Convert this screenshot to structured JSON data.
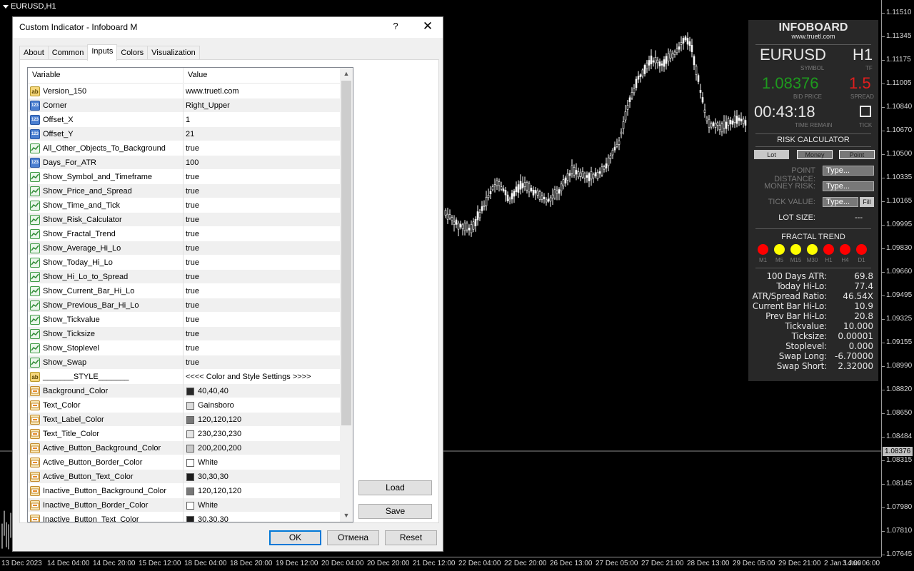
{
  "chart": {
    "symbol_tf": "EURUSD,H1",
    "price_labels": [
      "1.11510",
      "1.11345",
      "1.11175",
      "1.11005",
      "1.10840",
      "1.10670",
      "1.10500",
      "1.10335",
      "1.10165",
      "1.09995",
      "1.09830",
      "1.09660",
      "1.09495",
      "1.09325",
      "1.09155",
      "1.08990",
      "1.08820",
      "1.08650",
      "1.08484",
      "1.08315",
      "1.08145",
      "1.07980",
      "1.07810",
      "1.07645"
    ],
    "current_price": "1.08376",
    "time_labels": [
      "13 Dec 2023",
      "14 Dec 04:00",
      "14 Dec 20:00",
      "15 Dec 12:00",
      "18 Dec 04:00",
      "18 Dec 20:00",
      "19 Dec 12:00",
      "20 Dec 04:00",
      "20 Dec 20:00",
      "21 Dec 12:00",
      "22 Dec 04:00",
      "22 Dec 20:00",
      "26 Dec 13:00",
      "27 Dec 05:00",
      "27 Dec 21:00",
      "28 Dec 13:00",
      "29 Dec 05:00",
      "29 Dec 21:00",
      "2 Jan 14:00",
      "3 Jan 06:00"
    ],
    "colors": {
      "candle": "#ffffff",
      "axis": "#9a9a9a",
      "bid_line": "#8c8c8c"
    }
  },
  "infoboard": {
    "title": "INFOBOARD",
    "url": "www.truetl.com",
    "symbol": "EURUSD",
    "symbol_caption": "SYMBOL",
    "timeframe": "H1",
    "timeframe_caption": "TF",
    "bid_price": "1.08376",
    "bid_caption": "BID PRICE",
    "spread": "1.5",
    "spread_caption": "SPREAD",
    "time_remain": "00:43:18",
    "time_caption": "TIME REMAIN",
    "tick_caption": "TICK",
    "risk_title": "RISK CALCULATOR",
    "btn_lot": "Lot",
    "btn_money": "Money",
    "btn_point": "Point",
    "point_distance_label": "POINT DISTANCE:",
    "money_risk_label": "MONEY RISK:",
    "tick_value_label": "TICK VALUE:",
    "type_placeholder": "Type...",
    "fill_label": "Fill",
    "lot_size_label": "LOT SIZE:",
    "lot_size_value": "---",
    "fractal_title": "FRACTAL TREND",
    "fractal": [
      {
        "tf": "M1",
        "color": "#ff0000"
      },
      {
        "tf": "M5",
        "color": "#ffff00"
      },
      {
        "tf": "M15",
        "color": "#ffff00"
      },
      {
        "tf": "M30",
        "color": "#ffff00"
      },
      {
        "tf": "H1",
        "color": "#ff0000"
      },
      {
        "tf": "H4",
        "color": "#ff0000"
      },
      {
        "tf": "D1",
        "color": "#ff0000"
      }
    ],
    "stats": [
      {
        "label": "100 Days ATR:",
        "value": "69.8"
      },
      {
        "label": "Today Hi-Lo:",
        "value": "77.4"
      },
      {
        "label": "ATR/Spread Ratio:",
        "value": "46.54X"
      },
      {
        "label": "Current Bar Hi-Lo:",
        "value": "10.9"
      },
      {
        "label": "Prev Bar Hi-Lo:",
        "value": "20.8"
      },
      {
        "label": "Tickvalue:",
        "value": "10.000"
      },
      {
        "label": "Ticksize:",
        "value": "0.00001"
      },
      {
        "label": "Stoplevel:",
        "value": "0.000"
      },
      {
        "label": "Swap Long:",
        "value": "-6.70000"
      },
      {
        "label": "Swap Short:",
        "value": "2.32000"
      }
    ],
    "colors": {
      "bid": "#1e9a1e",
      "spread": "#e01e1e",
      "bg": "#282828"
    }
  },
  "dialog": {
    "title": "Custom Indicator - Infoboard M",
    "help": "?",
    "close": "✕",
    "tabs": [
      "About",
      "Common",
      "Inputs",
      "Colors",
      "Visualization"
    ],
    "active_tab": 2,
    "col_variable": "Variable",
    "col_value": "Value",
    "rows": [
      {
        "icon": "ab",
        "name": "Version_150",
        "value": "www.truetl.com"
      },
      {
        "icon": "123",
        "name": "Corner",
        "value": "Right_Upper"
      },
      {
        "icon": "123",
        "name": "Offset_X",
        "value": "1"
      },
      {
        "icon": "123",
        "name": "Offset_Y",
        "value": "21"
      },
      {
        "icon": "bool",
        "name": "All_Other_Objects_To_Background",
        "value": "true"
      },
      {
        "icon": "123",
        "name": "Days_For_ATR",
        "value": "100"
      },
      {
        "icon": "bool",
        "name": "Show_Symbol_and_Timeframe",
        "value": "true"
      },
      {
        "icon": "bool",
        "name": "Show_Price_and_Spread",
        "value": "true"
      },
      {
        "icon": "bool",
        "name": "Show_Time_and_Tick",
        "value": "true"
      },
      {
        "icon": "bool",
        "name": "Show_Risk_Calculator",
        "value": "true"
      },
      {
        "icon": "bool",
        "name": "Show_Fractal_Trend",
        "value": "true"
      },
      {
        "icon": "bool",
        "name": "Show_Average_Hi_Lo",
        "value": "true"
      },
      {
        "icon": "bool",
        "name": "Show_Today_Hi_Lo",
        "value": "true"
      },
      {
        "icon": "bool",
        "name": "Show_Hi_Lo_to_Spread",
        "value": "true"
      },
      {
        "icon": "bool",
        "name": "Show_Current_Bar_Hi_Lo",
        "value": "true"
      },
      {
        "icon": "bool",
        "name": "Show_Previous_Bar_Hi_Lo",
        "value": "true"
      },
      {
        "icon": "bool",
        "name": "Show_Tickvalue",
        "value": "true"
      },
      {
        "icon": "bool",
        "name": "Show_Ticksize",
        "value": "true"
      },
      {
        "icon": "bool",
        "name": "Show_Stoplevel",
        "value": "true"
      },
      {
        "icon": "bool",
        "name": "Show_Swap",
        "value": "true"
      },
      {
        "icon": "ab",
        "name": "_______STYLE_______",
        "value": "<<<< Color and Style Settings >>>>"
      },
      {
        "icon": "clr",
        "name": "Background_Color",
        "value": "40,40,40",
        "swatch": "#282828"
      },
      {
        "icon": "clr",
        "name": "Text_Color",
        "value": "Gainsboro",
        "swatch": "#dcdcdc"
      },
      {
        "icon": "clr",
        "name": "Text_Label_Color",
        "value": "120,120,120",
        "swatch": "#787878"
      },
      {
        "icon": "clr",
        "name": "Text_Title_Color",
        "value": "230,230,230",
        "swatch": "#e6e6e6"
      },
      {
        "icon": "clr",
        "name": "Active_Button_Background_Color",
        "value": "200,200,200",
        "swatch": "#c8c8c8"
      },
      {
        "icon": "clr",
        "name": "Active_Button_Border_Color",
        "value": "White",
        "swatch": "#ffffff"
      },
      {
        "icon": "clr",
        "name": "Active_Button_Text_Color",
        "value": "30,30,30",
        "swatch": "#1e1e1e"
      },
      {
        "icon": "clr",
        "name": "Inactive_Button_Background_Color",
        "value": "120,120,120",
        "swatch": "#787878"
      },
      {
        "icon": "clr",
        "name": "Inactive_Button_Border_Color",
        "value": "White",
        "swatch": "#ffffff"
      },
      {
        "icon": "clr",
        "name": "Inactive_Button_Text_Color",
        "value": "30,30,30",
        "swatch": "#1e1e1e"
      }
    ],
    "btn_load": "Load",
    "btn_save": "Save",
    "btn_ok": "OK",
    "btn_cancel": "Отмена",
    "btn_reset": "Reset"
  }
}
